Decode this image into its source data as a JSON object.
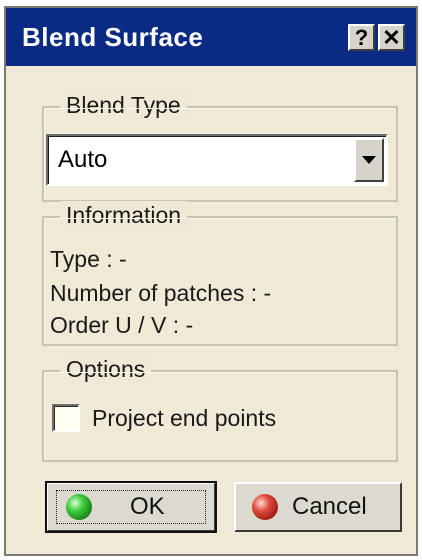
{
  "dialog": {
    "title": "Blend Surface",
    "help_label": "?",
    "close_label": "✕"
  },
  "blend_type": {
    "legend": "Blend Type",
    "selected": "Auto"
  },
  "information": {
    "legend": "Information",
    "lines": [
      "Type : -",
      "Number of patches : -",
      "Order U / V : -"
    ]
  },
  "options": {
    "legend": "Options",
    "project_end_points": {
      "label": "Project end points",
      "checked": false
    }
  },
  "buttons": {
    "ok_label": "OK",
    "cancel_label": "Cancel"
  },
  "colors": {
    "titlebar": "#0b2a84",
    "dialog_bg": "#efe9d6",
    "ok_icon": "#3dcb3a",
    "cancel_icon": "#e0483c"
  }
}
